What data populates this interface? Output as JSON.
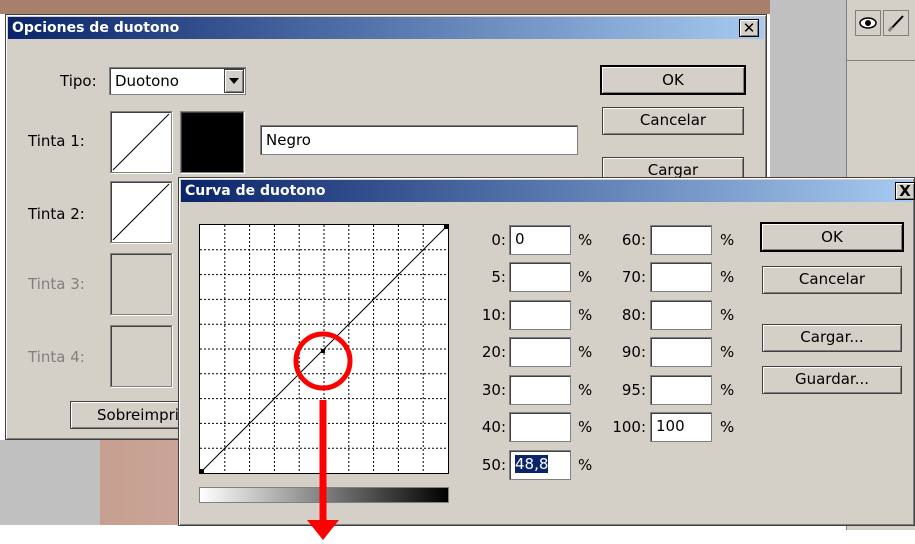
{
  "duotone_dialog": {
    "title": "Opciones de duotono",
    "type_label": "Tipo:",
    "type_value": "Duotono",
    "ink1_label": "Tinta 1:",
    "ink1_name": "Negro",
    "ink2_label": "Tinta 2:",
    "ink3_label": "Tinta 3:",
    "ink4_label": "Tinta 4:",
    "overprint_label": "Sobreimprir",
    "ok_label": "OK",
    "cancel_label": "Cancelar",
    "load_label": "Cargar"
  },
  "curve_dialog": {
    "title": "Curva de duotono",
    "close_label": "X",
    "ok_label": "OK",
    "cancel_label": "Cancelar",
    "load_label": "Cargar...",
    "save_label": "Guardar...",
    "percent_sign": "%",
    "fields_left": [
      {
        "key": "0:",
        "value": "0"
      },
      {
        "key": "5:",
        "value": ""
      },
      {
        "key": "10:",
        "value": ""
      },
      {
        "key": "20:",
        "value": ""
      },
      {
        "key": "30:",
        "value": ""
      },
      {
        "key": "40:",
        "value": ""
      },
      {
        "key": "50:",
        "value": "48,8"
      }
    ],
    "fields_right": [
      {
        "key": "60:",
        "value": ""
      },
      {
        "key": "70:",
        "value": ""
      },
      {
        "key": "80:",
        "value": ""
      },
      {
        "key": "90:",
        "value": ""
      },
      {
        "key": "95:",
        "value": ""
      },
      {
        "key": "100:",
        "value": "100"
      }
    ]
  },
  "colors": {
    "titlebar_start": "#0a246a",
    "titlebar_end": "#a6caf0",
    "annotation": "#ff0000"
  }
}
